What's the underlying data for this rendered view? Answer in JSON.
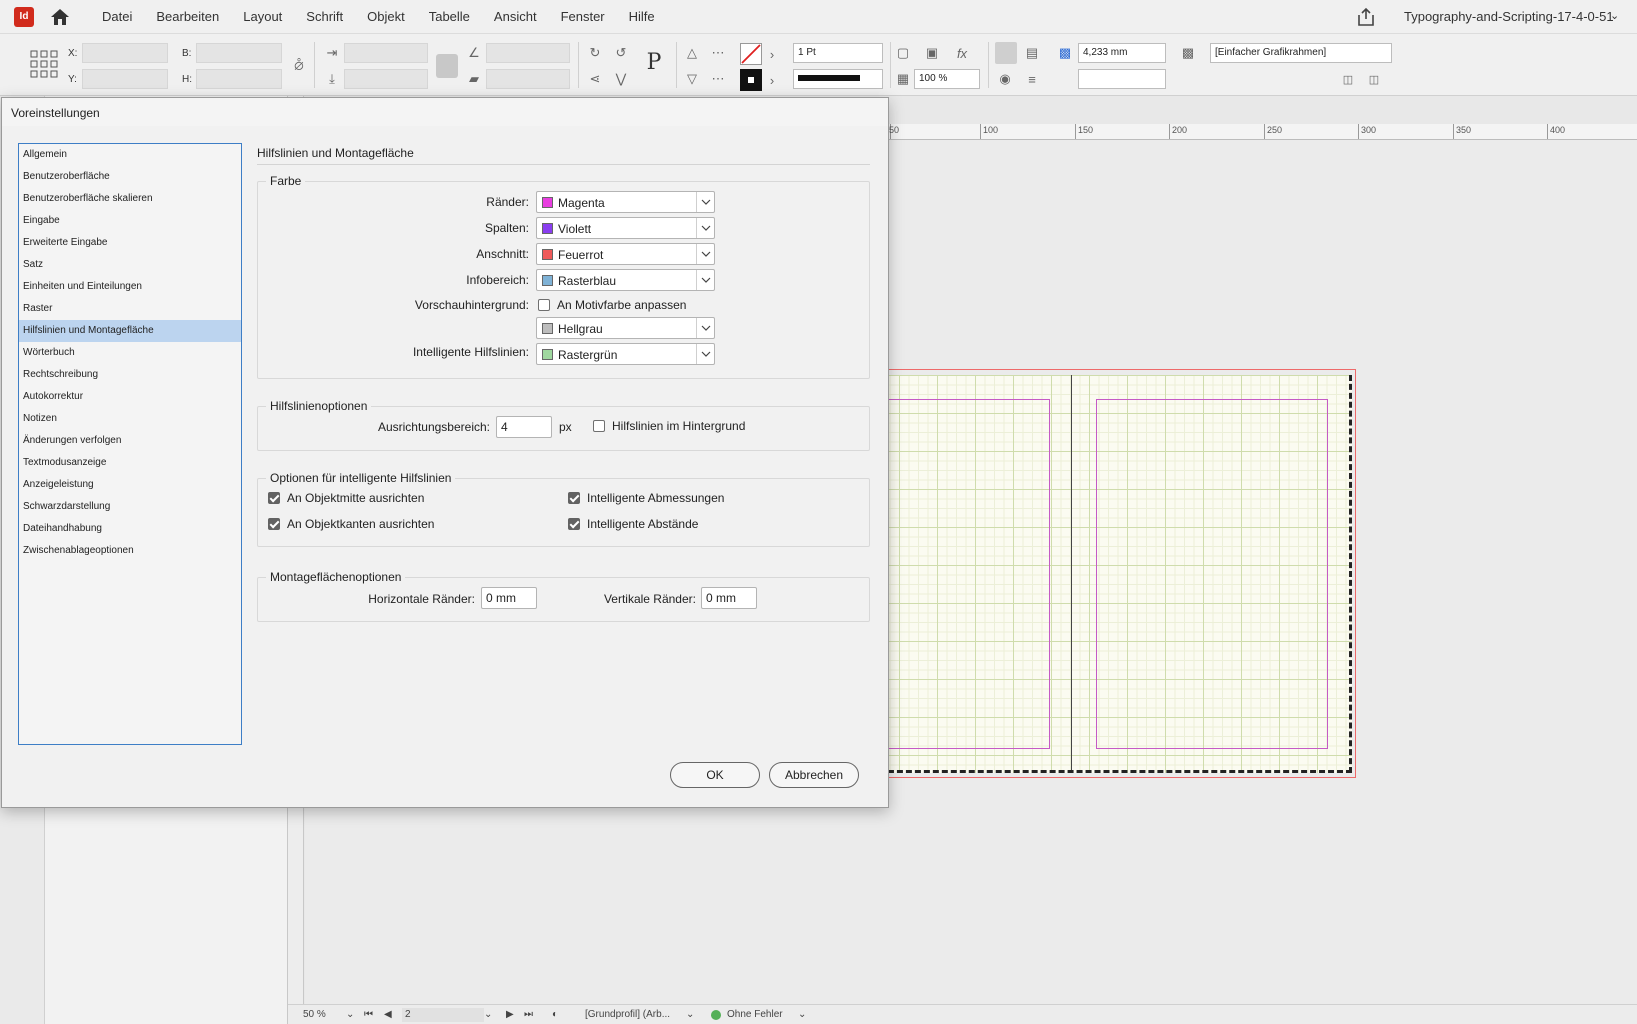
{
  "app": {
    "logo_text": "Id",
    "menu": [
      "Datei",
      "Bearbeiten",
      "Layout",
      "Schrift",
      "Objekt",
      "Tabelle",
      "Ansicht",
      "Fenster",
      "Hilfe"
    ],
    "document_title": "Typography-and-Scripting-17-4-0-51"
  },
  "control_bar": {
    "x_label": "X:",
    "y_label": "Y:",
    "w_label": "B:",
    "h_label": "H:",
    "stroke_weight": "1 Pt",
    "opacity": "100 %",
    "dimension": "4,233 mm",
    "frame_style": "[Einfacher Grafikrahmen]"
  },
  "ruler": [
    "50",
    "100",
    "150",
    "200",
    "250",
    "300",
    "350",
    "400"
  ],
  "statusbar": {
    "zoom": "50 %",
    "page": "2",
    "profile": "[Grundprofil] (Arb...",
    "preflight": "Ohne Fehler"
  },
  "dialog": {
    "title": "Voreinstellungen",
    "categories": [
      "Allgemein",
      "Benutzeroberfläche",
      "Benutzeroberfläche skalieren",
      "Eingabe",
      "Erweiterte Eingabe",
      "Satz",
      "Einheiten und Einteilungen",
      "Raster",
      "Hilfslinien und Montagefläche",
      "Wörterbuch",
      "Rechtschreibung",
      "Autokorrektur",
      "Notizen",
      "Änderungen verfolgen",
      "Textmodusanzeige",
      "Anzeigeleistung",
      "Schwarzdarstellung",
      "Dateihandhabung",
      "Zwischenablageoptionen"
    ],
    "active_category_index": 8,
    "section_title": "Hilfslinien und Montagefläche",
    "farbe": {
      "legend": "Farbe",
      "raender": {
        "label": "Ränder:",
        "value": "Magenta",
        "swatch": "#e83ee0"
      },
      "spalten": {
        "label": "Spalten:",
        "value": "Violett",
        "swatch": "#8a3ef0"
      },
      "anschnitt": {
        "label": "Anschnitt:",
        "value": "Feuerrot",
        "swatch": "#ef5a5a"
      },
      "infobereich": {
        "label": "Infobereich:",
        "value": "Rasterblau",
        "swatch": "#7fb2d6"
      },
      "vorschau": {
        "label": "Vorschauhintergrund:",
        "checkbox_label": "An Motivfarbe anpassen",
        "checked": false,
        "value": "Hellgrau",
        "swatch": "#bdbdbd"
      },
      "intelligent": {
        "label": "Intelligente Hilfslinien:",
        "value": "Rastergrün",
        "swatch": "#9fd89f"
      }
    },
    "hilfslinienoptionen": {
      "legend": "Hilfslinienoptionen",
      "ausrichtung_label": "Ausrichtungsbereich:",
      "ausrichtung_value": "4",
      "ausrichtung_unit": "px",
      "hintergrund_label": "Hilfslinien im Hintergrund",
      "hintergrund_checked": false
    },
    "intelligente_optionen": {
      "legend": "Optionen für intelligente Hilfslinien",
      "objektmitte": "An Objektmitte ausrichten",
      "objektkanten": "An Objektkanten ausrichten",
      "abmessungen": "Intelligente Abmessungen",
      "abstaende": "Intelligente Abstände",
      "all_checked": true
    },
    "montageflaeche": {
      "legend": "Montageflächenoptionen",
      "horizontal_label": "Horizontale Ränder:",
      "horizontal_value": "0 mm",
      "vertikal_label": "Vertikale Ränder:",
      "vertikal_value": "0 mm"
    },
    "ok_label": "OK",
    "cancel_label": "Abbrechen"
  }
}
